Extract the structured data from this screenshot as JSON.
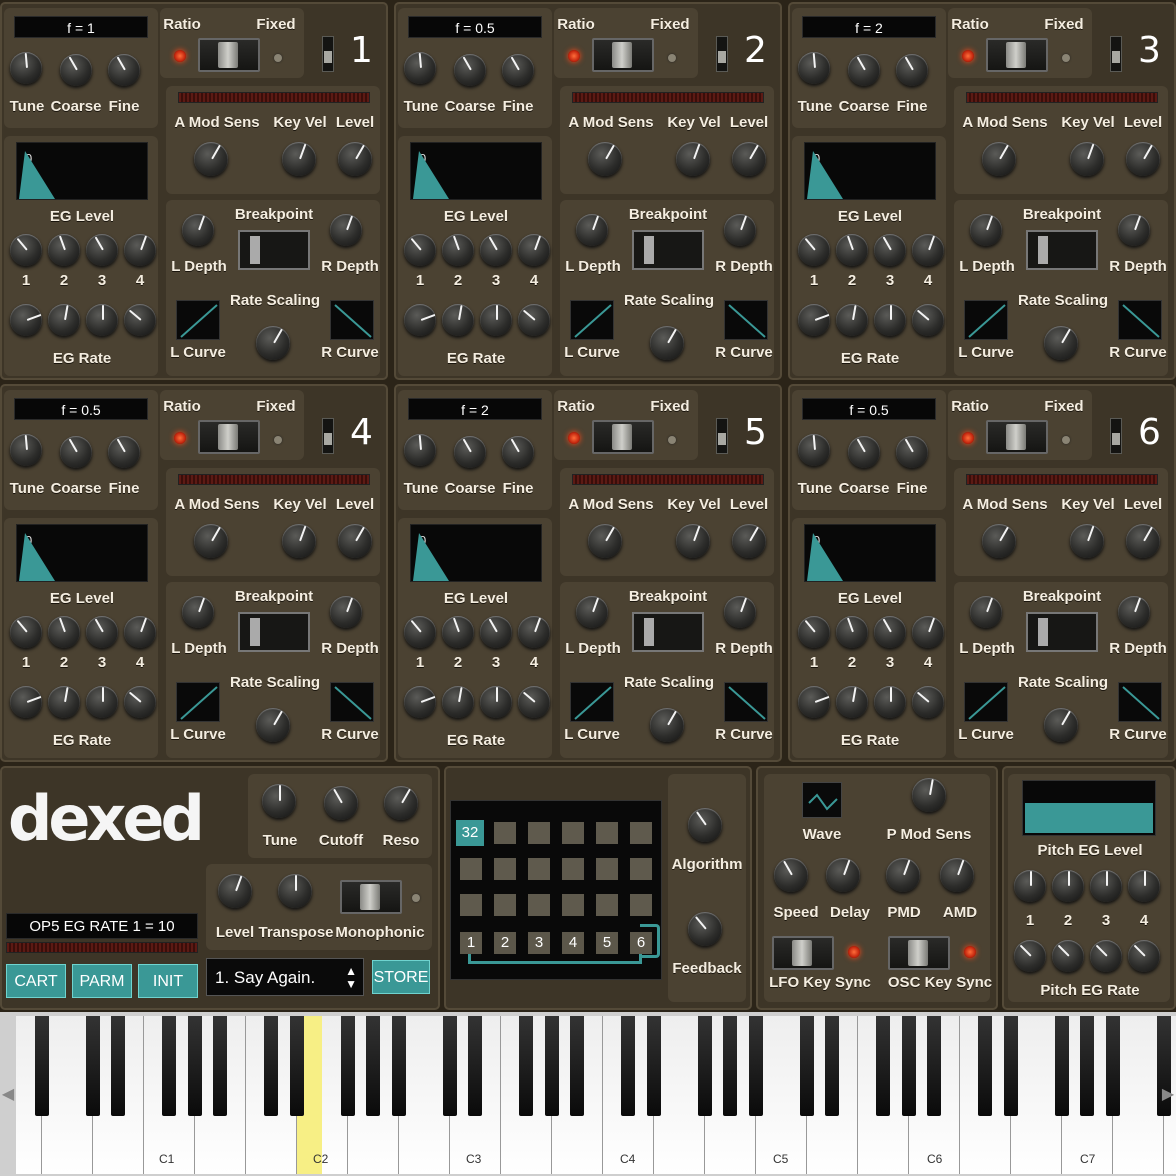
{
  "operators": [
    {
      "number": "1",
      "freq": "f = 1",
      "eg_value": "0"
    },
    {
      "number": "2",
      "freq": "f = 0.5",
      "eg_value": "0"
    },
    {
      "number": "3",
      "freq": "f = 2",
      "eg_value": "0"
    },
    {
      "number": "4",
      "freq": "f = 0.5",
      "eg_value": "0"
    },
    {
      "number": "5",
      "freq": "f = 2",
      "eg_value": "0"
    },
    {
      "number": "6",
      "freq": "f = 0.5",
      "eg_value": "0"
    }
  ],
  "op_labels": {
    "ratio": "Ratio",
    "fixed": "Fixed",
    "tune": "Tune",
    "coarse": "Coarse",
    "fine": "Fine",
    "amod": "A Mod Sens",
    "keyvel": "Key Vel",
    "level": "Level",
    "eglevel": "EG Level",
    "egrate": "EG Rate",
    "n1": "1",
    "n2": "2",
    "n3": "3",
    "n4": "4",
    "ldepth": "L Depth",
    "breakpoint": "Breakpoint",
    "rdepth": "R Depth",
    "ratescaling": "Rate Scaling",
    "lcurve": "L Curve",
    "rcurve": "R Curve"
  },
  "global": {
    "logo": "dexed",
    "tune": "Tune",
    "cutoff": "Cutoff",
    "reso": "Reso",
    "level": "Level",
    "transpose": "Transpose",
    "monophonic": "Monophonic",
    "status": "OP5 EG RATE 1 = 10",
    "cart": "CART",
    "parm": "PARM",
    "init": "INIT",
    "program": "1. Say Again.",
    "store": "STORE"
  },
  "algorithm": {
    "label": "Algorithm",
    "feedback": "Feedback",
    "number": "32",
    "ops": [
      "1",
      "2",
      "3",
      "4",
      "5",
      "6"
    ]
  },
  "lfo": {
    "wave": "Wave",
    "pmodsens": "P Mod Sens",
    "speed": "Speed",
    "delay": "Delay",
    "pmd": "PMD",
    "amd": "AMD",
    "lfosync": "LFO Key Sync",
    "oscsync": "OSC Key Sync"
  },
  "pitcheg": {
    "level": "Pitch EG Level",
    "rate": "Pitch EG Rate",
    "n1": "1",
    "n2": "2",
    "n3": "3",
    "n4": "4"
  },
  "keyboard": {
    "labels": [
      "C1",
      "C2",
      "C3",
      "C4",
      "C5",
      "C6",
      "C7"
    ],
    "highlight": "#f7ef85"
  },
  "colors": {
    "accent": "#3a9896",
    "led": "#ff4a1a"
  }
}
